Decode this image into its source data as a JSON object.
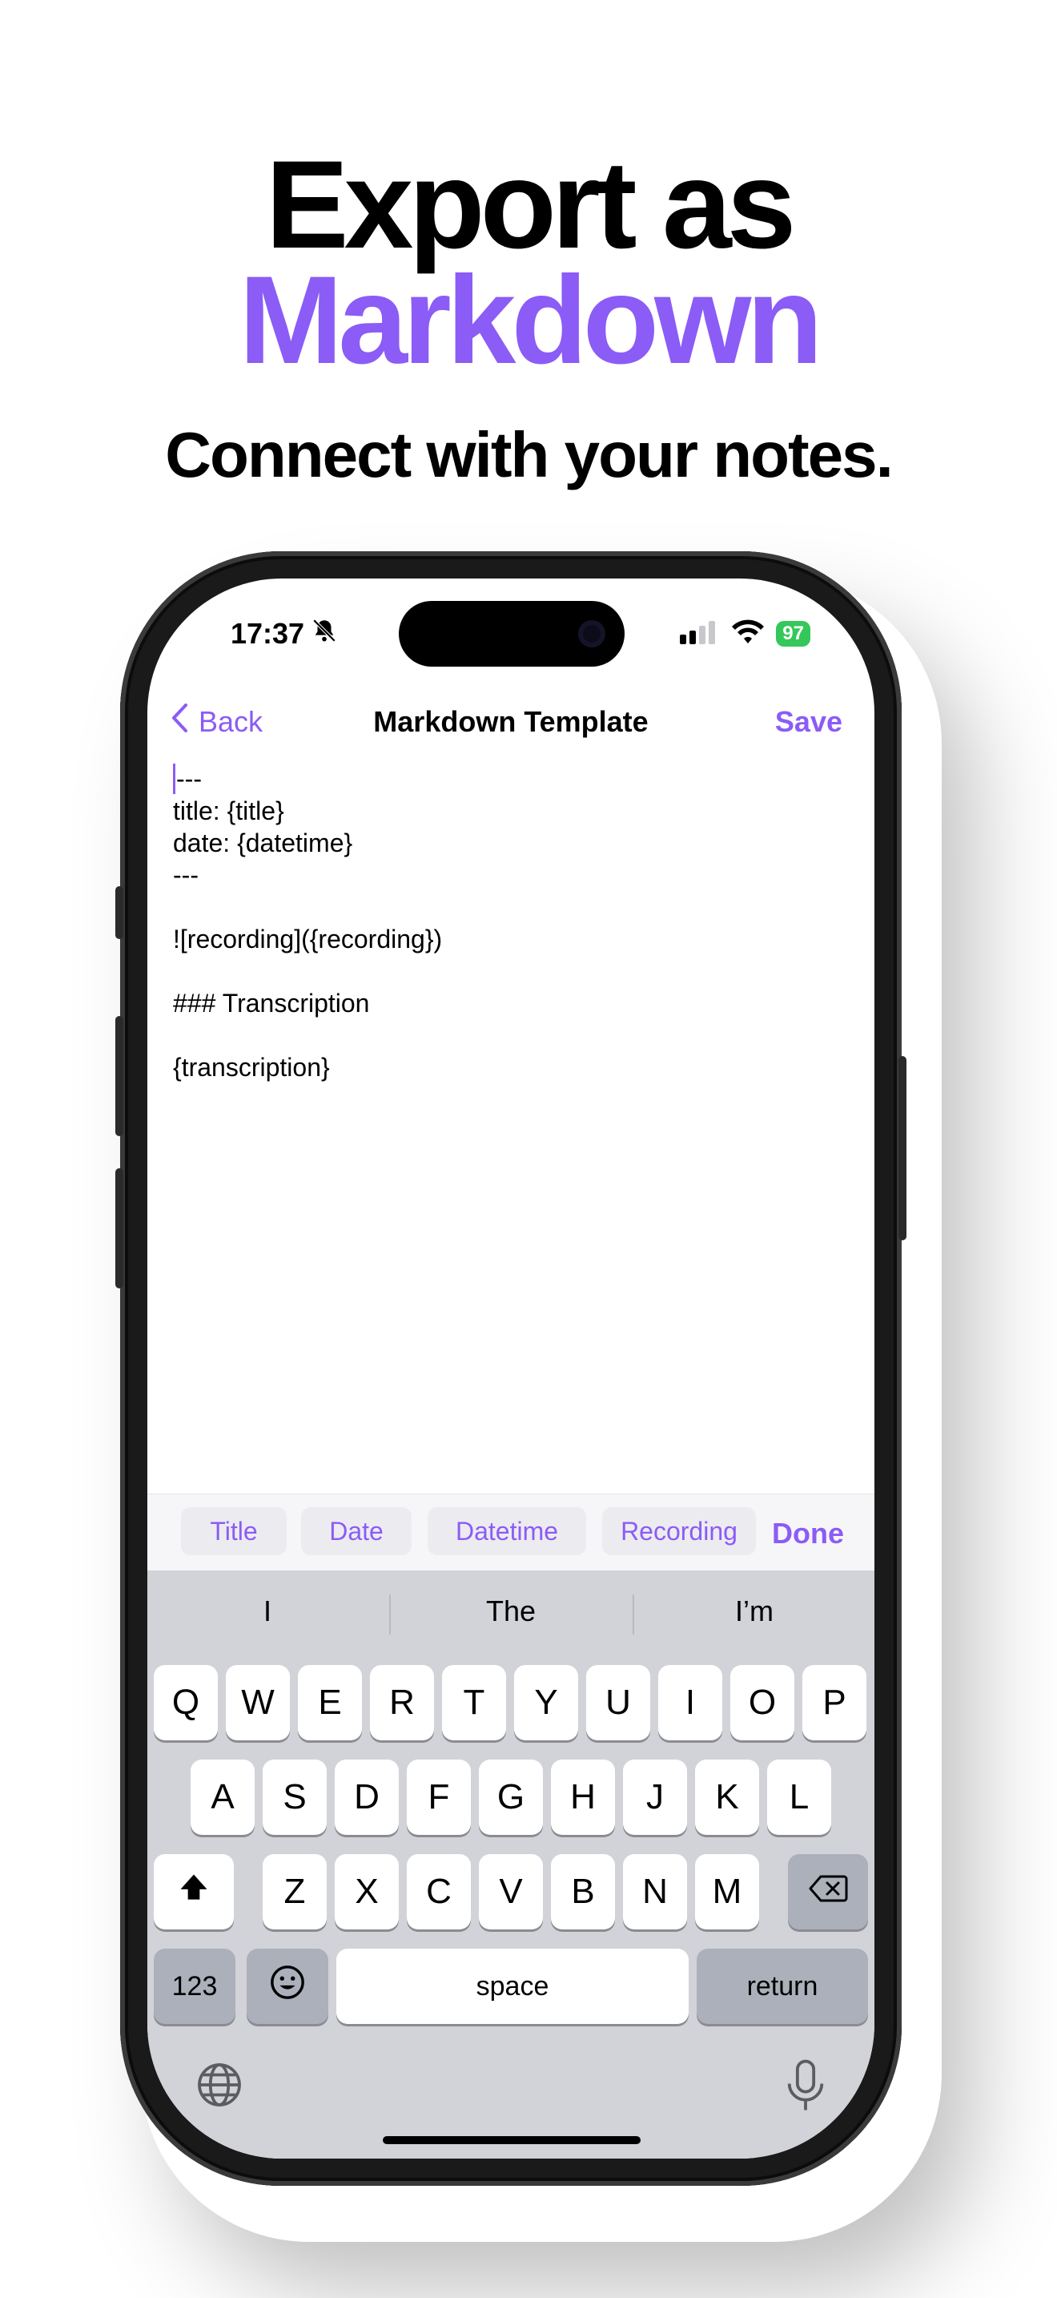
{
  "headline": {
    "line1": "Export as",
    "line2": "Markdown",
    "subtitle": "Connect with your notes."
  },
  "colors": {
    "accent": "#8b5cf6",
    "battery": "#34c759"
  },
  "status_bar": {
    "time": "17:37",
    "battery": "97"
  },
  "nav": {
    "back_label": "Back",
    "title": "Markdown Template",
    "save_label": "Save"
  },
  "editor": {
    "lines": [
      "---",
      "title: {title}",
      "date: {datetime}",
      "---",
      "",
      "![recording]({recording})",
      "",
      "### Transcription",
      "",
      "{transcription}"
    ]
  },
  "toolbar": {
    "chips": [
      "Title",
      "Date",
      "Datetime",
      "Recording"
    ],
    "done_label": "Done"
  },
  "keyboard": {
    "suggestions": [
      "I",
      "The",
      "I’m"
    ],
    "row1": [
      "Q",
      "W",
      "E",
      "R",
      "T",
      "Y",
      "U",
      "I",
      "O",
      "P"
    ],
    "row2": [
      "A",
      "S",
      "D",
      "F",
      "G",
      "H",
      "J",
      "K",
      "L"
    ],
    "row3": [
      "Z",
      "X",
      "C",
      "V",
      "B",
      "N",
      "M"
    ],
    "numbers_label": "123",
    "space_label": "space",
    "return_label": "return"
  },
  "icons": {
    "bell_slash": "bell-slash-icon",
    "signal": "signal-icon",
    "wifi": "wifi-icon",
    "shift": "shift-icon",
    "delete": "delete-icon",
    "emoji": "emoji-icon",
    "globe": "globe-icon",
    "mic": "microphone-icon"
  }
}
